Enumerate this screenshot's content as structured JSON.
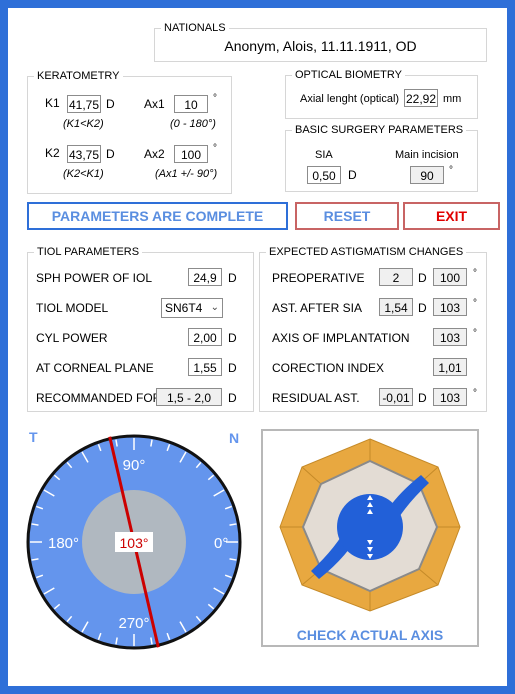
{
  "nationals": {
    "title": "NATIONALS",
    "value": "Anonym, Alois, 11.11.1911, OD"
  },
  "keratometry": {
    "title": "KERATOMETRY",
    "k1_label": "K1",
    "k1_value": "41,75",
    "k1_unit": "D",
    "k1_hint": "(K1<K2)",
    "ax1_label": "Ax1",
    "ax1_value": "10",
    "ax1_hint": "(0 - 180°)",
    "k2_label": "K2",
    "k2_value": "43,75",
    "k2_unit": "D",
    "k2_hint": "(K2<K1)",
    "ax2_label": "Ax2",
    "ax2_value": "100",
    "ax2_hint": "(Ax1 +/- 90°)",
    "degree": "°"
  },
  "optical_biometry": {
    "title": "OPTICAL BIOMETRY",
    "axial_label": "Axial lenght (optical)",
    "axial_value": "22,92",
    "axial_unit": "mm"
  },
  "surgery": {
    "title": "BASIC SURGERY PARAMETERS",
    "sia_label": "SIA",
    "sia_value": "0,50",
    "sia_unit": "D",
    "incision_label": "Main incision",
    "incision_value": "90",
    "incision_unit": "°"
  },
  "buttons": {
    "status": "PARAMETERS ARE COMPLETE",
    "reset": "RESET",
    "exit": "EXIT",
    "check": "CHECK ACTUAL AXIS"
  },
  "tiol": {
    "title": "TIOL PARAMETERS",
    "sph_label": "SPH POWER OF IOL",
    "sph_value": "24,9",
    "sph_unit": "D",
    "model_label": "TIOL MODEL",
    "model_value": "SN6T4",
    "cyl_label": "CYL POWER",
    "cyl_value": "2,00",
    "cyl_unit": "D",
    "corneal_label": "AT CORNEAL PLANE",
    "corneal_value": "1,55",
    "corneal_unit": "D",
    "recommended_label": "RECOMMANDED FOR",
    "recommended_value": "1,5 - 2,0",
    "recommended_unit": "D"
  },
  "astig": {
    "title": "EXPECTED ASTIGMATISM CHANGES",
    "pre_label": "PREOPERATIVE",
    "pre_value": "2",
    "pre_unit": "D",
    "pre_axis": "100",
    "after_label": "AST. AFTER SIA",
    "after_value": "1,54",
    "after_unit": "D",
    "after_axis": "103",
    "implant_label": "AXIS OF IMPLANTATION",
    "implant_axis": "103",
    "index_label": "CORECTION INDEX",
    "index_value": "1,01",
    "residual_label": "RESIDUAL AST.",
    "residual_value": "-0,01",
    "residual_unit": "D",
    "residual_axis": "103",
    "degree": "°"
  },
  "dial": {
    "left_marker": "T",
    "right_marker": "N",
    "label_90": "90°",
    "label_180": "180°",
    "label_0": "0°",
    "label_270": "270°",
    "axis_readout": "103°",
    "axis_value": 103
  },
  "colors": {
    "accent_blue": "#2e6fd8",
    "dial_blue": "#6495ed",
    "dial_grey": "#b0b8c0",
    "axis_red": "#cc0000",
    "exit_red": "#e00000",
    "lens_orange": "#e8a840",
    "lens_blue": "#2260d8"
  }
}
